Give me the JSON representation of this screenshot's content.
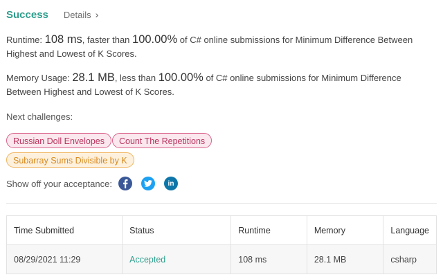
{
  "header": {
    "status": "Success",
    "details_label": "Details"
  },
  "runtime_stat": {
    "prefix": "Runtime: ",
    "value": "108 ms",
    "middle": ", faster than ",
    "percent": "100.00%",
    "suffix": " of C# online submissions for Minimum Difference Between Highest and Lowest of K Scores."
  },
  "memory_stat": {
    "prefix": "Memory Usage: ",
    "value": "28.1 MB",
    "middle": ", less than ",
    "percent": "100.00%",
    "suffix": " of C# online submissions for Minimum Difference Between Highest and Lowest of K Scores."
  },
  "next_challenges": {
    "label": "Next challenges:",
    "items": [
      {
        "label": "Russian Doll Envelopes",
        "difficulty": "hard"
      },
      {
        "label": "Count The Repetitions",
        "difficulty": "hard"
      },
      {
        "label": "Subarray Sums Divisible by K",
        "difficulty": "medium"
      }
    ]
  },
  "share": {
    "label": "Show off your acceptance:",
    "icons": [
      "facebook-icon",
      "twitter-icon",
      "linkedin-icon"
    ]
  },
  "colors": {
    "success": "#2e9e8c",
    "hard_chip": "#d9638b",
    "medium_chip": "#f0b35c",
    "facebook": "#3b5998",
    "twitter": "#1da1f2",
    "linkedin": "#0e76a8"
  },
  "submissions": {
    "headers": [
      "Time Submitted",
      "Status",
      "Runtime",
      "Memory",
      "Language"
    ],
    "rows": [
      {
        "time": "08/29/2021 11:29",
        "status": "Accepted",
        "runtime": "108 ms",
        "memory": "28.1 MB",
        "language": "csharp"
      }
    ]
  }
}
